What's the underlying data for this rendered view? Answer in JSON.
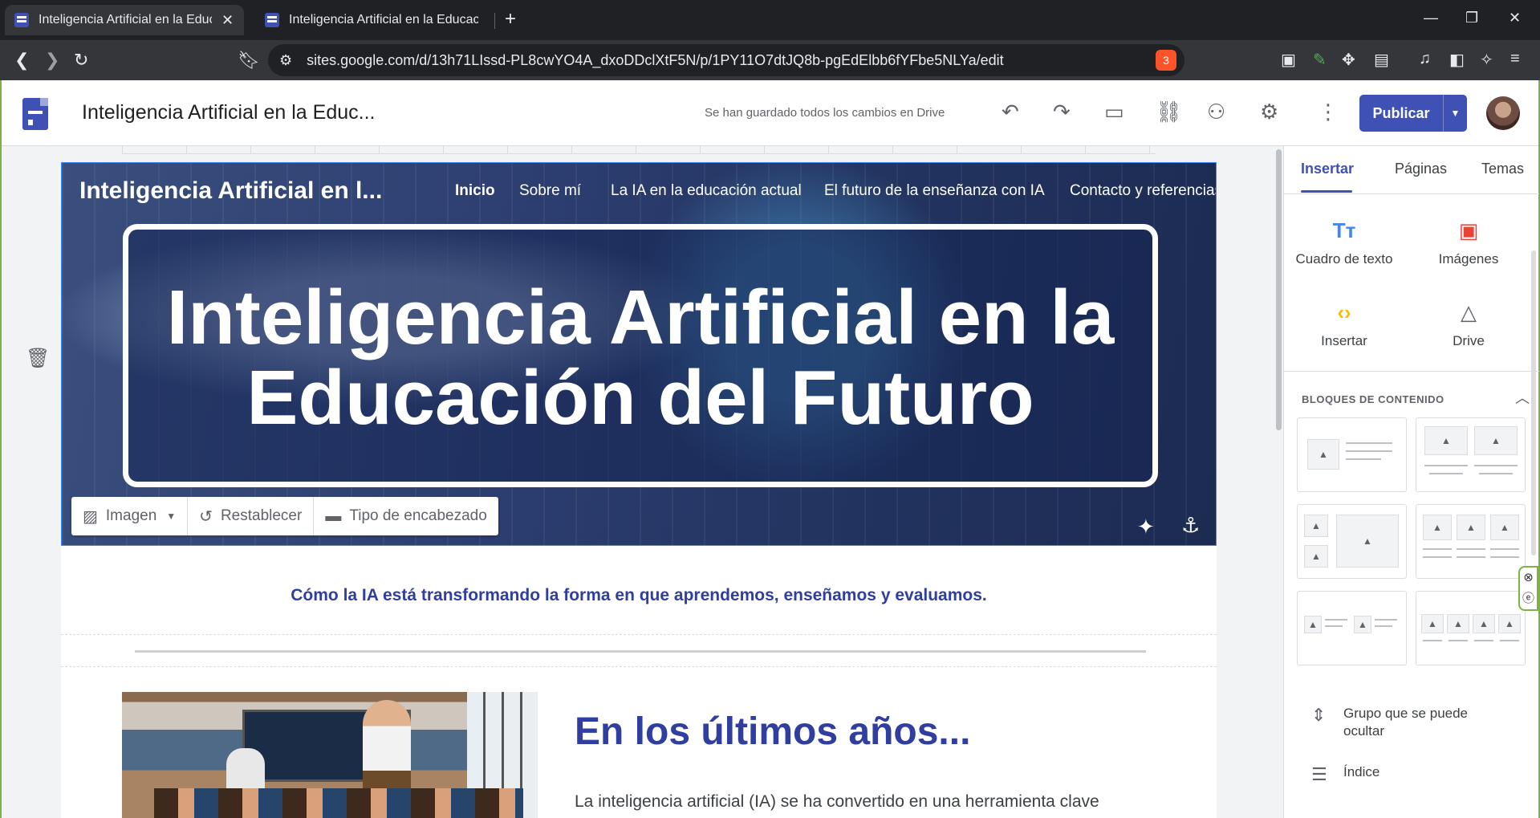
{
  "browser": {
    "tabs": [
      {
        "title": "Inteligencia Artificial en la Educación",
        "active": true
      },
      {
        "title": "Inteligencia Artificial en la Educación",
        "active": false
      }
    ],
    "url": "sites.google.com/d/13h71LIssd-PL8cwYO4A_dxoDDclXtF5N/p/1PY11O7dtJQ8b-pgEdElbb6fYFbe5NLYa/edit",
    "brave_badge": "3"
  },
  "sites": {
    "doc_title": "Inteligencia Artificial en la Educ...",
    "saved_status": "Se han guardado todos los cambios en Drive",
    "publish_label": "Publicar"
  },
  "site": {
    "name": "Inteligencia Artificial en l...",
    "nav": [
      "Inicio",
      "Sobre mí",
      "La IA en la educación actual",
      "El futuro de la enseñanza con IA",
      "Contacto y referencias"
    ],
    "hero_title": "Inteligencia Artificial en la Educación del Futuro",
    "hero_tools": {
      "image": "Imagen",
      "reset": "Restablecer",
      "header_type": "Tipo de encabezado"
    },
    "subtitle": "Cómo la IA está transformando la forma en que aprendemos, enseñamos y evaluamos.",
    "section_title": "En los últimos años...",
    "body_text": "La inteligencia artificial (IA) se ha convertido en una herramienta clave"
  },
  "panel": {
    "tabs": [
      "Insertar",
      "Páginas",
      "Temas"
    ],
    "items": [
      "Cuadro de texto",
      "Imágenes",
      "Insertar",
      "Drive"
    ],
    "blocks_header": "BLOQUES DE CONTENIDO",
    "list": [
      "Grupo que se puede ocultar",
      "Índice"
    ]
  },
  "colors": {
    "accent": "#3f51b5",
    "title_blue": "#303f9f",
    "browser_dark": "#202124"
  }
}
